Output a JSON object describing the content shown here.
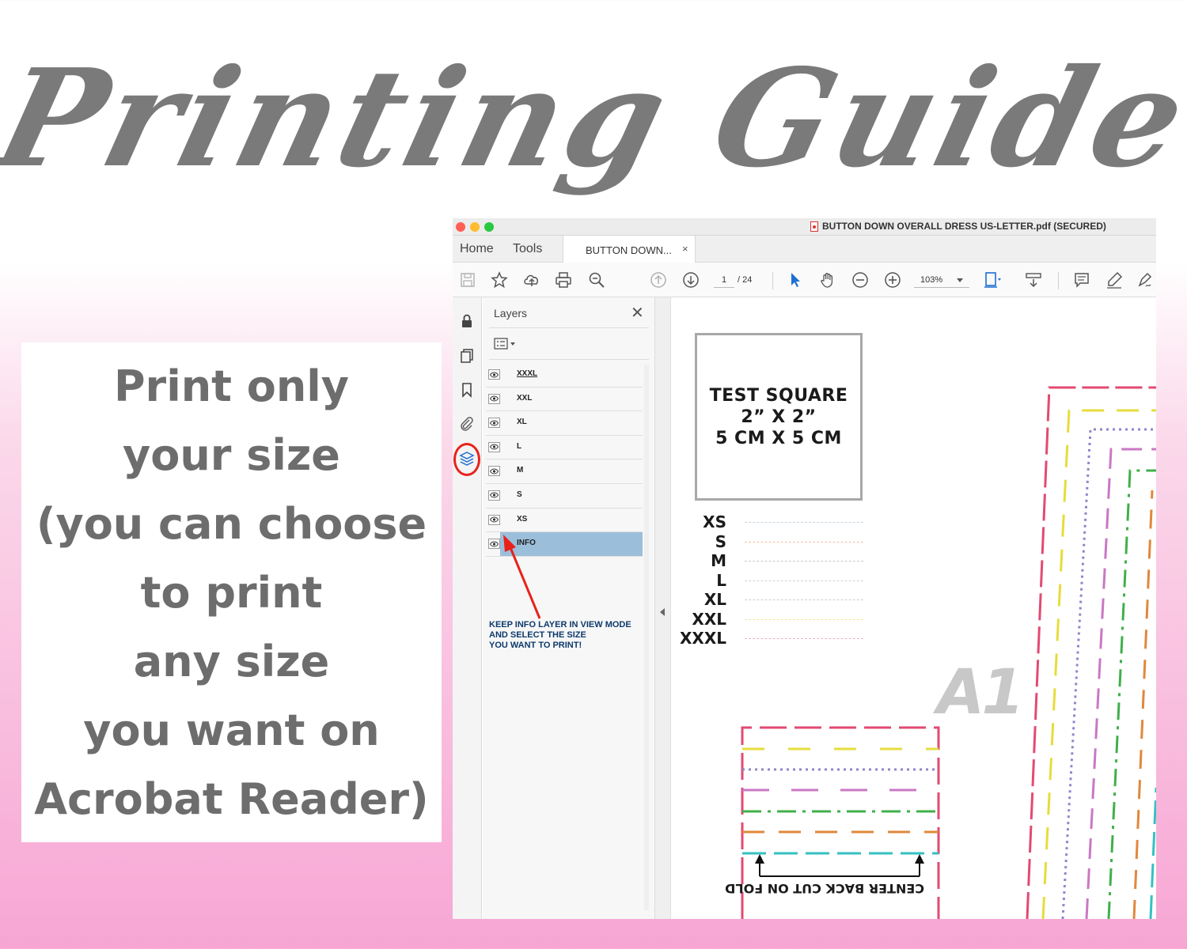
{
  "title": "Printing Guide",
  "instructions": [
    "Print only",
    "your size",
    "(you can choose",
    "to print",
    "any size",
    "you want on",
    "Acrobat Reader)"
  ],
  "window": {
    "document_title": "BUTTON DOWN OVERALL DRESS US-LETTER.pdf (SECURED)",
    "nav": {
      "home": "Home",
      "tools": "Tools"
    },
    "tab": {
      "label": "BUTTON DOWN...",
      "close": "×"
    },
    "toolbar": {
      "page_current": "1",
      "page_total": "/ 24",
      "zoom": "103%"
    }
  },
  "layers_panel": {
    "title": "Layers",
    "close": "✕",
    "layers": [
      {
        "name": "XXXL",
        "visible": true,
        "selected": false
      },
      {
        "name": "XXL",
        "visible": true,
        "selected": false
      },
      {
        "name": "XL",
        "visible": true,
        "selected": false
      },
      {
        "name": "L",
        "visible": true,
        "selected": false
      },
      {
        "name": "M",
        "visible": true,
        "selected": false
      },
      {
        "name": "S",
        "visible": true,
        "selected": false
      },
      {
        "name": "XS",
        "visible": true,
        "selected": false
      },
      {
        "name": "INFO",
        "visible": true,
        "selected": true
      }
    ],
    "annotation": [
      "KEEP INFO LAYER IN VIEW MODE",
      "AND SELECT THE SIZE",
      "YOU WANT TO PRINT!"
    ]
  },
  "page": {
    "test_square": [
      "TEST SQUARE",
      "2” X 2”",
      "5 CM X 5 CM"
    ],
    "size_legend": [
      {
        "label": "XS",
        "color": "#c9d6e3"
      },
      {
        "label": "S",
        "color": "#f3c1a6"
      },
      {
        "label": "M",
        "color": "#c9c9c9"
      },
      {
        "label": "L",
        "color": "#d3d3d3"
      },
      {
        "label": "XL",
        "color": "#cfcfcf"
      },
      {
        "label": "XXL",
        "color": "#f2e9a0"
      },
      {
        "label": "XXXL",
        "color": "#f2b4c4"
      }
    ],
    "pattern_mark": "A1",
    "fold_label": "CENTER BACK CUT ON FOLD"
  },
  "colors": {
    "title_gray": "#7a7a7a",
    "highlight_red": "#e8221b",
    "selection_blue": "#9bbfdb",
    "line_pink": "#e24a72",
    "line_yellow": "#e6dc3c",
    "line_purple": "#8d87c9",
    "line_lilac": "#c978c4",
    "line_green": "#3fb04a",
    "line_orange": "#e0883c",
    "line_teal": "#35c0c2"
  }
}
